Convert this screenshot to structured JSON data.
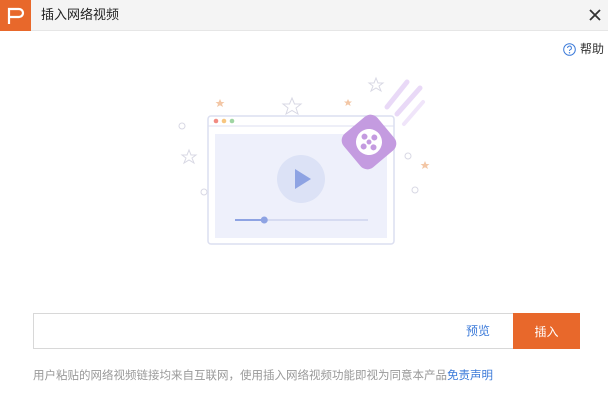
{
  "window": {
    "title": "插入网络视频",
    "close_icon": "close-icon",
    "logo_icon": "wps-p-logo-icon"
  },
  "help": {
    "label": "帮助",
    "icon": "question-circle-icon"
  },
  "illustration": {
    "icon": "video-player-illustration",
    "progress": 0.22
  },
  "url_input": {
    "value": "",
    "placeholder": ""
  },
  "actions": {
    "preview_label": "预览",
    "insert_label": "插入"
  },
  "disclaimer": {
    "text": "用户粘贴的网络视频链接均来自互联网，使用插入网络视频功能即视为同意本产品",
    "link_label": "免责声明"
  },
  "colors": {
    "accent": "#e8682b",
    "link": "#3b7ad9",
    "muted_text": "#999999",
    "illustration_purple": "#c49be0",
    "illustration_blue": "#8ea3e3"
  }
}
